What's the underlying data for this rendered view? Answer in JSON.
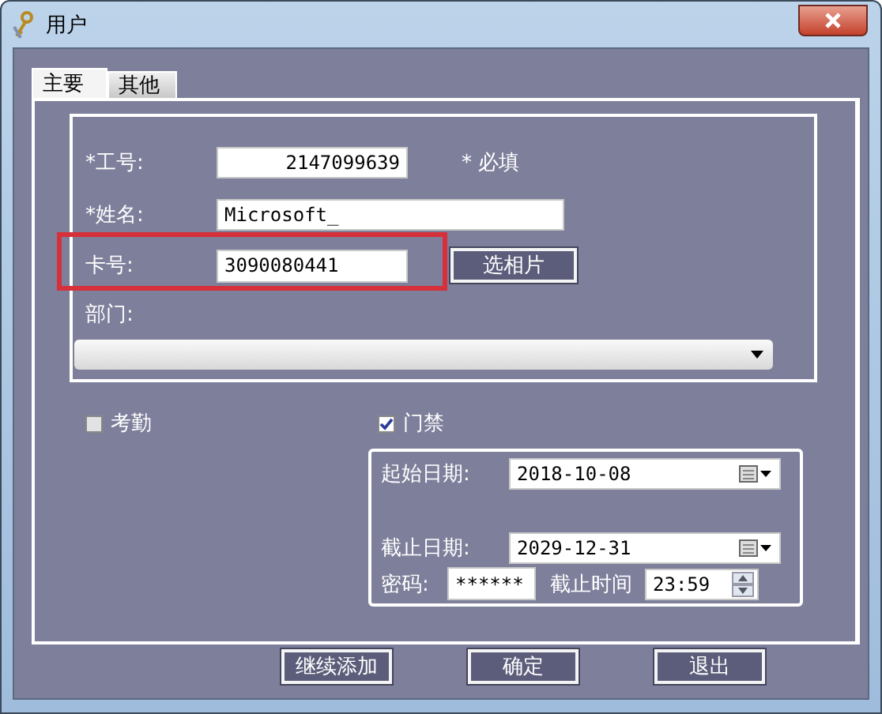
{
  "window": {
    "title": "用户"
  },
  "tabs": [
    {
      "label": "主要",
      "selected": true
    },
    {
      "label": "其他",
      "selected": false
    }
  ],
  "fields": [
    {
      "kind": "id",
      "label": "*工号:",
      "value": "2147099639",
      "note": "* 必填",
      "highlighted": false
    },
    {
      "kind": "text",
      "label": "*姓名:",
      "value": "Microsoft_",
      "highlighted": false
    },
    {
      "kind": "card",
      "label": "卡号:",
      "value": "3090080441",
      "button": "选相片",
      "highlighted": true
    }
  ],
  "department": {
    "label": "部门:"
  },
  "checks": [
    {
      "label": "考勤",
      "checked": false
    },
    {
      "label": "门禁",
      "checked": true
    }
  ],
  "access": {
    "start_date": {
      "label": "起始日期:",
      "value": "2018-10-08"
    },
    "end_date": {
      "label": "截止日期:",
      "value": "2029-12-31"
    },
    "password": {
      "label": "密码:",
      "value": "******"
    },
    "end_time": {
      "label": "截止时间",
      "value": "23:59"
    }
  },
  "buttons": [
    "继续添加",
    "确定",
    "退出"
  ]
}
